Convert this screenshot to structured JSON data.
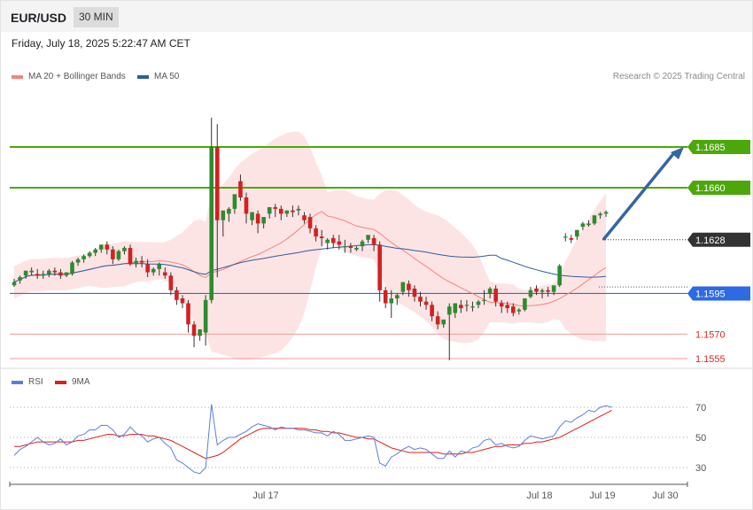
{
  "header": {
    "symbol": "EUR/USD",
    "timeframe": "30 MIN"
  },
  "timestamp": "Friday, July 18, 2025 5:22:47 AM CET",
  "legend_main": [
    {
      "label": "MA 20 + Bollinger Bands",
      "color": "#f4827f"
    },
    {
      "label": "MA 50",
      "color": "#2e5d9e"
    }
  ],
  "credit": "Research © 2025 Trading Central",
  "legend_rsi": [
    {
      "label": "RSI",
      "color": "#5b7fd6"
    },
    {
      "label": "9MA",
      "color": "#e01d1d"
    }
  ],
  "colors": {
    "up": "#2e8b2e",
    "down": "#d61f1f",
    "resistance": "#4ca80a",
    "pivot": "#2d6ae3",
    "support": "#f09a9a",
    "last": "#333333",
    "arrow": "#3465a4",
    "band": "#fde4e4"
  },
  "chart_data": {
    "type": "candlestick",
    "ylim": [
      1.155,
      1.1705
    ],
    "x_ticks": [
      "Jul 17",
      "Jul 18",
      "Jul 19",
      "Jul 30"
    ],
    "levels": [
      {
        "value": 1.1685,
        "label": "1.1685",
        "type": "resistance"
      },
      {
        "value": 1.166,
        "label": "1.1660",
        "type": "resistance"
      },
      {
        "value": 1.1628,
        "label": "1.1628",
        "type": "last"
      },
      {
        "value": 1.1595,
        "label": "1.1595",
        "type": "pivot"
      },
      {
        "value": 1.157,
        "label": "1.1570",
        "type": "support"
      },
      {
        "value": 1.1555,
        "label": "1.1555",
        "type": "support"
      }
    ],
    "candles": [
      [
        1.16,
        1.1604,
        1.1602,
        1.1599
      ],
      [
        1.1603,
        1.1606,
        1.1605,
        1.1601
      ],
      [
        1.1606,
        1.1609,
        1.1609,
        1.1604
      ],
      [
        1.1608,
        1.1611,
        1.1609,
        1.1606
      ],
      [
        1.1607,
        1.161,
        1.1606,
        1.1604
      ],
      [
        1.1606,
        1.1609,
        1.1607,
        1.1604
      ],
      [
        1.1607,
        1.161,
        1.1609,
        1.1605
      ],
      [
        1.1609,
        1.1611,
        1.1608,
        1.1606
      ],
      [
        1.1608,
        1.161,
        1.1606,
        1.1604
      ],
      [
        1.1606,
        1.1608,
        1.1608,
        1.1605
      ],
      [
        1.1607,
        1.1615,
        1.1614,
        1.1606
      ],
      [
        1.1614,
        1.1617,
        1.1616,
        1.1612
      ],
      [
        1.1616,
        1.1619,
        1.1618,
        1.1614
      ],
      [
        1.1618,
        1.1621,
        1.162,
        1.1617
      ],
      [
        1.162,
        1.1623,
        1.1622,
        1.1618
      ],
      [
        1.1622,
        1.1625,
        1.1625,
        1.162
      ],
      [
        1.1625,
        1.1627,
        1.1622,
        1.1619
      ],
      [
        1.1622,
        1.1624,
        1.1616,
        1.1613
      ],
      [
        1.1616,
        1.1622,
        1.1621,
        1.1615
      ],
      [
        1.1621,
        1.1624,
        1.1623,
        1.1619
      ],
      [
        1.1623,
        1.1625,
        1.1613,
        1.1612
      ],
      [
        1.1613,
        1.1617,
        1.1615,
        1.1611
      ],
      [
        1.1615,
        1.1618,
        1.1614,
        1.1611
      ],
      [
        1.1613,
        1.1616,
        1.1608,
        1.1605
      ],
      [
        1.1608,
        1.1611,
        1.161,
        1.1606
      ],
      [
        1.161,
        1.1614,
        1.1613,
        1.1606
      ],
      [
        1.1608,
        1.1611,
        1.1606,
        1.1604
      ],
      [
        1.1606,
        1.1608,
        1.1597,
        1.1594
      ],
      [
        1.1597,
        1.1599,
        1.1591,
        1.1588
      ],
      [
        1.1592,
        1.1594,
        1.1589,
        1.1586
      ],
      [
        1.1589,
        1.1591,
        1.1576,
        1.1571
      ],
      [
        1.1576,
        1.1578,
        1.1569,
        1.1562
      ],
      [
        1.1569,
        1.1573,
        1.1573,
        1.1566
      ],
      [
        1.1571,
        1.1594,
        1.1591,
        1.1563
      ],
      [
        1.1591,
        1.1703,
        1.1685,
        1.1589
      ],
      [
        1.1685,
        1.1699,
        1.164,
        1.1605
      ],
      [
        1.164,
        1.1645,
        1.1646,
        1.163
      ],
      [
        1.1644,
        1.1648,
        1.1647,
        1.1639
      ],
      [
        1.1647,
        1.1654,
        1.1656,
        1.1644
      ],
      [
        1.1664,
        1.1668,
        1.1654,
        1.1652
      ],
      [
        1.1654,
        1.1657,
        1.1644,
        1.1638
      ],
      [
        1.164,
        1.1643,
        1.1645,
        1.1637
      ],
      [
        1.1644,
        1.1646,
        1.1638,
        1.1632
      ],
      [
        1.1638,
        1.164,
        1.1642,
        1.1635
      ],
      [
        1.1644,
        1.1648,
        1.1648,
        1.1641
      ],
      [
        1.1648,
        1.165,
        1.1647,
        1.1642
      ],
      [
        1.1647,
        1.1649,
        1.1644,
        1.164
      ],
      [
        1.1644,
        1.1646,
        1.1646,
        1.1642
      ],
      [
        1.1646,
        1.1649,
        1.1645,
        1.1642
      ],
      [
        1.1646,
        1.1649,
        1.1647,
        1.1643
      ],
      [
        1.1643,
        1.1645,
        1.164,
        1.1638
      ],
      [
        1.1642,
        1.1644,
        1.1635,
        1.1632
      ],
      [
        1.1635,
        1.1637,
        1.163,
        1.1627
      ],
      [
        1.163,
        1.1634,
        1.1629,
        1.1624
      ],
      [
        1.1626,
        1.1629,
        1.1628,
        1.1622
      ],
      [
        1.1629,
        1.1631,
        1.1626,
        1.1623
      ],
      [
        1.1627,
        1.1631,
        1.1625,
        1.1622
      ],
      [
        1.1624,
        1.1628,
        1.1624,
        1.162
      ],
      [
        1.1624,
        1.1626,
        1.1623,
        1.162
      ],
      [
        1.1622,
        1.1624,
        1.1623,
        1.1621
      ],
      [
        1.1624,
        1.1628,
        1.1627,
        1.1621
      ],
      [
        1.1628,
        1.163,
        1.1631,
        1.1626
      ],
      [
        1.1629,
        1.1631,
        1.1625,
        1.1621
      ],
      [
        1.1625,
        1.1627,
        1.1597,
        1.159
      ],
      [
        1.1597,
        1.1599,
        1.1589,
        1.1586
      ],
      [
        1.1589,
        1.1597,
        1.1592,
        1.158
      ],
      [
        1.1592,
        1.1595,
        1.1594,
        1.1588
      ],
      [
        1.1596,
        1.1599,
        1.1602,
        1.1594
      ],
      [
        1.1601,
        1.1603,
        1.1597,
        1.1593
      ],
      [
        1.1598,
        1.16,
        1.1593,
        1.159
      ],
      [
        1.1593,
        1.1596,
        1.159,
        1.1587
      ],
      [
        1.159,
        1.1593,
        1.1588,
        1.1585
      ],
      [
        1.1588,
        1.159,
        1.1581,
        1.1578
      ],
      [
        1.1581,
        1.1584,
        1.1576,
        1.1573
      ],
      [
        1.1576,
        1.1579,
        1.1579,
        1.1574
      ],
      [
        1.1582,
        1.1589,
        1.1587,
        1.1554
      ],
      [
        1.1583,
        1.1585,
        1.1589,
        1.158
      ],
      [
        1.1588,
        1.1591,
        1.1586,
        1.1583
      ],
      [
        1.1588,
        1.1591,
        1.1588,
        1.1584
      ],
      [
        1.1587,
        1.159,
        1.1587,
        1.1584
      ],
      [
        1.1588,
        1.1591,
        1.159,
        1.1586
      ],
      [
        1.1591,
        1.1597,
        1.1591,
        1.1588
      ],
      [
        1.1595,
        1.1599,
        1.1598,
        1.1592
      ],
      [
        1.1598,
        1.16,
        1.159,
        1.1587
      ],
      [
        1.1589,
        1.1591,
        1.1587,
        1.1583
      ],
      [
        1.1588,
        1.159,
        1.1586,
        1.1583
      ],
      [
        1.1587,
        1.1589,
        1.1583,
        1.1581
      ],
      [
        1.1584,
        1.1586,
        1.1585,
        1.1582
      ],
      [
        1.1585,
        1.1591,
        1.1592,
        1.1584
      ],
      [
        1.1593,
        1.1599,
        1.1597,
        1.1592
      ],
      [
        1.1598,
        1.16,
        1.1596,
        1.1594
      ],
      [
        1.1596,
        1.1598,
        1.1597,
        1.1592
      ],
      [
        1.1597,
        1.1599,
        1.1596,
        1.1593
      ],
      [
        1.1596,
        1.1598,
        1.16,
        1.1594
      ],
      [
        1.16,
        1.1613,
        1.1612,
        1.1599
      ],
      [
        1.163,
        1.1632,
        1.163,
        1.1627
      ],
      [
        1.1629,
        1.1631,
        1.1628,
        1.1626
      ],
      [
        1.163,
        1.1634,
        1.1634,
        1.1628
      ],
      [
        1.1636,
        1.1639,
        1.1638,
        1.1634
      ],
      [
        1.1637,
        1.164,
        1.1638,
        1.1636
      ],
      [
        1.1638,
        1.1643,
        1.1643,
        1.1637
      ],
      [
        1.1643,
        1.1645,
        1.1644,
        1.1641
      ],
      [
        1.1644,
        1.1646,
        1.1645,
        1.1642
      ]
    ],
    "rsi_ticks": [
      70,
      50,
      30
    ],
    "rsi": [
      38,
      42,
      44,
      47,
      50,
      47,
      45,
      46,
      49,
      45,
      47,
      51,
      52,
      55,
      55,
      58,
      58,
      55,
      50,
      52,
      57,
      53,
      51,
      47,
      49,
      50,
      46,
      43,
      35,
      33,
      30,
      27,
      26,
      30,
      72,
      45,
      48,
      50,
      50,
      52,
      54,
      57,
      59,
      58,
      57,
      55,
      57,
      56,
      56,
      55,
      55,
      54,
      53,
      53,
      51,
      54,
      52,
      48,
      48,
      49,
      50,
      51,
      50,
      33,
      31,
      37,
      39,
      42,
      44,
      42,
      43,
      42,
      39,
      36,
      36,
      41,
      37,
      41,
      40,
      43,
      44,
      48,
      49,
      45,
      46,
      44,
      43,
      44,
      48,
      51,
      50,
      49,
      50,
      51,
      57,
      61,
      60,
      63,
      65,
      68,
      67,
      70,
      71,
      70
    ],
    "rsi_ma": [
      44,
      44,
      45,
      46,
      47,
      47,
      47,
      47,
      47,
      47,
      47,
      48,
      48,
      49,
      50,
      51,
      52,
      52,
      51,
      51,
      52,
      52,
      52,
      51,
      51,
      50,
      49,
      48,
      46,
      44,
      42,
      40,
      38,
      36,
      37,
      38,
      40,
      43,
      46,
      49,
      51,
      53,
      55,
      56,
      56,
      56,
      56,
      56,
      56,
      56,
      56,
      55,
      55,
      54,
      54,
      53,
      53,
      52,
      51,
      50,
      50,
      49,
      49,
      47,
      45,
      43,
      42,
      41,
      40,
      40,
      40,
      40,
      40,
      40,
      39,
      39,
      39,
      39,
      40,
      40,
      41,
      42,
      43,
      44,
      44,
      45,
      45,
      45,
      46,
      46,
      47,
      47,
      48,
      49,
      50,
      52,
      54,
      56,
      58,
      60,
      62,
      64,
      66,
      68
    ]
  }
}
